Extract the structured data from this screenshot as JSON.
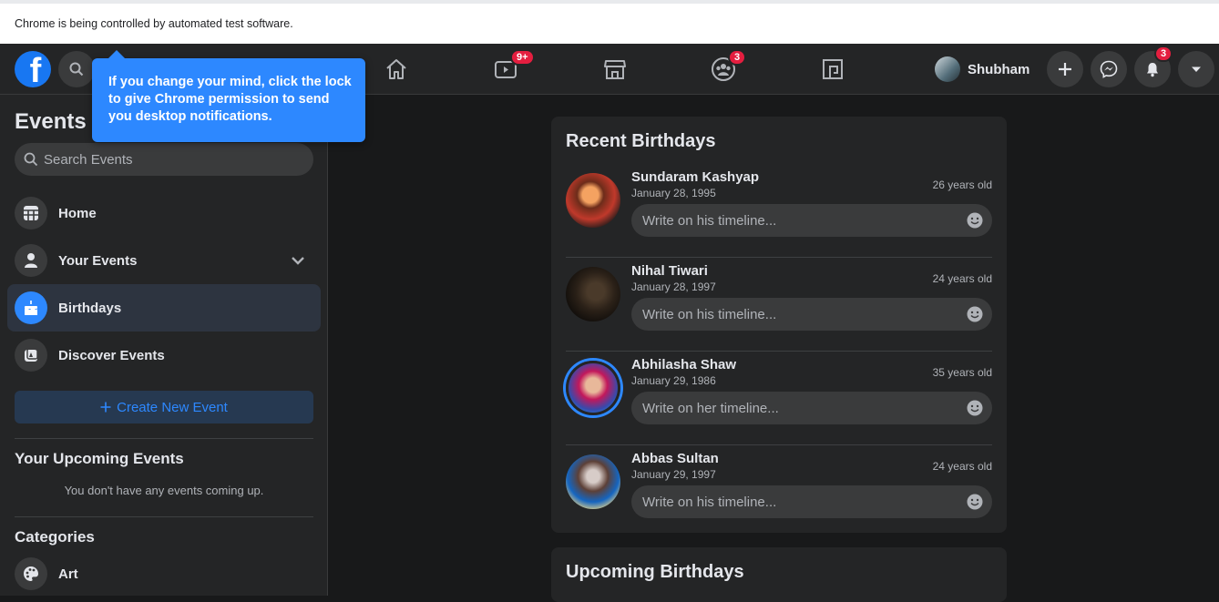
{
  "infobar": {
    "text": "Chrome is being controlled by automated test software."
  },
  "topbar": {
    "logo": "f",
    "tabs": [
      {
        "name": "home",
        "icon": "home-icon",
        "badge": ""
      },
      {
        "name": "watch",
        "icon": "watch-icon",
        "badge": "9+"
      },
      {
        "name": "marketplace",
        "icon": "marketplace-icon",
        "badge": ""
      },
      {
        "name": "groups",
        "icon": "groups-icon",
        "badge": "3"
      },
      {
        "name": "gaming",
        "icon": "gaming-icon",
        "badge": ""
      }
    ],
    "profile_name": "Shubham",
    "notifications_badge": "3"
  },
  "tooltip": {
    "text": "If you change your mind, click the lock to give Chrome permission to send you desktop notifications."
  },
  "sidebar": {
    "title": "Events",
    "search_placeholder": "Search Events",
    "items": [
      {
        "label": "Home",
        "icon": "calendar-grid-icon"
      },
      {
        "label": "Your Events",
        "icon": "person-icon"
      },
      {
        "label": "Birthdays",
        "icon": "cake-icon"
      },
      {
        "label": "Discover Events",
        "icon": "discover-icon"
      }
    ],
    "create_label": "Create New Event",
    "upcoming_title": "Your Upcoming Events",
    "upcoming_empty": "You don't have any events coming up.",
    "categories_title": "Categories",
    "categories": [
      {
        "label": "Art",
        "icon": "palette-icon"
      }
    ]
  },
  "recent": {
    "title": "Recent Birthdays",
    "people": [
      {
        "name": "Sundaram Kashyap",
        "date": "January 28, 1995",
        "age": "26 years old",
        "placeholder": "Write on his timeline..."
      },
      {
        "name": "Nihal Tiwari",
        "date": "January 28, 1997",
        "age": "24 years old",
        "placeholder": "Write on his timeline..."
      },
      {
        "name": "Abhilasha Shaw",
        "date": "January 29, 1986",
        "age": "35 years old",
        "placeholder": "Write on her timeline..."
      },
      {
        "name": "Abbas Sultan",
        "date": "January 29, 1997",
        "age": "24 years old",
        "placeholder": "Write on his timeline..."
      }
    ]
  },
  "upcoming": {
    "title": "Upcoming Birthdays"
  },
  "colors": {
    "accent": "#2d88ff",
    "badge": "#e41e3f",
    "background": "#18191a",
    "surface": "#242526"
  }
}
